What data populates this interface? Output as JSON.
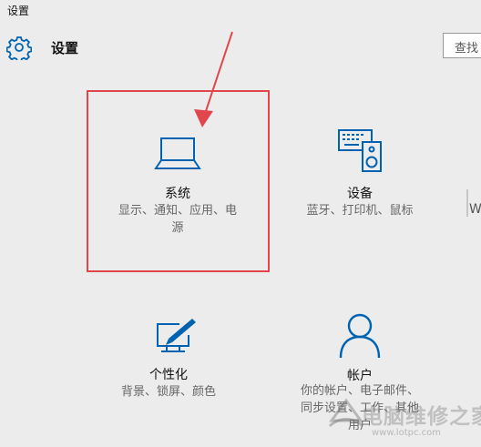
{
  "window": {
    "title": "设置"
  },
  "header": {
    "title": "设置",
    "gear_icon": "gear-icon",
    "search_placeholder": "查找"
  },
  "tiles": [
    {
      "id": "system",
      "icon": "laptop-icon",
      "title": "系统",
      "desc_line1": "显示、通知、应用、电",
      "desc_line2": "源"
    },
    {
      "id": "devices",
      "icon": "devices-icon",
      "title": "设备",
      "desc_line1": "蓝牙、打印机、鼠标"
    },
    {
      "id": "personalization",
      "icon": "personalization-icon",
      "title": "个性化",
      "desc_line1": "背景、锁屏、颜色"
    },
    {
      "id": "accounts",
      "icon": "person-icon",
      "title": "帐户",
      "desc_line1": "你的帐户、电子邮件、",
      "desc_line2": "同步设置、工作、其他",
      "desc_line3": "用户"
    }
  ],
  "partial_tile_text": "W",
  "annotation": {
    "highlight_color": "#e0474c"
  },
  "watermark": {
    "text": "电脑维修之家",
    "url": "www.lotpc.com"
  },
  "colors": {
    "accent": "#0063b1",
    "background": "#ececec"
  }
}
